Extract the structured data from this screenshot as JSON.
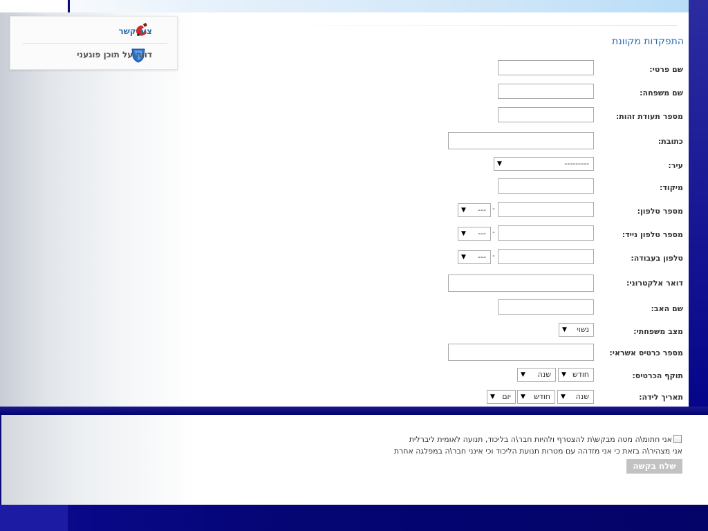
{
  "sidebar": {
    "items": [
      {
        "label": "צור קשר",
        "icon": "phone-icon"
      },
      {
        "label": "דווח על תוכן פוגעני",
        "icon": "shield-icon"
      }
    ]
  },
  "form": {
    "title": "התפקדות מקוונת",
    "labels": {
      "first_name": "שם פרטי:",
      "last_name": "שם משפחה:",
      "id_number": "מספר תעודת זהות:",
      "address": "כתובת:",
      "city": "עיר:",
      "zip": "מיקוד:",
      "phone": "מספר טלפון:",
      "mobile": "מספר טלפון נייד:",
      "work_phone": "טלפון בעבודה:",
      "email": "דואר אלקטרוני:",
      "father_name": "שם האב:",
      "marital_status": "מצב משפחתי:",
      "credit_card": "מספר כרטיס אשראי:",
      "card_expiry": "תוקף הכרטיס:",
      "birth_date": "תאריך לידה:"
    },
    "values": {
      "city": "---------",
      "phone_prefix": "---",
      "mobile_prefix": "---",
      "work_prefix": "---",
      "marital_status": "נשוי",
      "expiry_month": "חודש",
      "expiry_year": "שנה",
      "birth_year": "שנה",
      "birth_month": "חודש",
      "birth_day": "יום",
      "dash": "-"
    }
  },
  "agreement": {
    "line1": "אני חתומ\\ה מטה מבקש\\ת להצטרף ולהיות חבר\\ה בליכוד, תנועה לאומית ליברלית",
    "line2": "אני מצהיר\\ה בזאת כי אני מזדהה עם מטרות תנועת הליכוד וכי אינני חבר\\ה במפלגה אחרת"
  },
  "submit_label": "שלח בקשה"
}
